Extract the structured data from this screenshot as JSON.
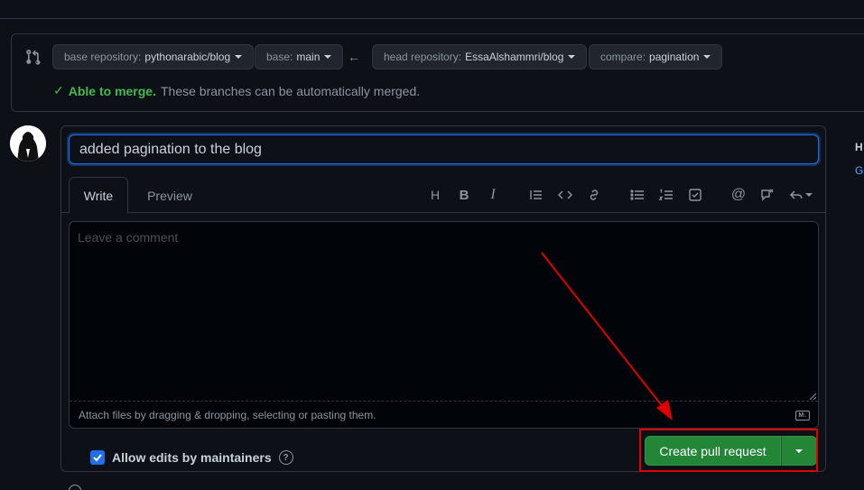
{
  "compare": {
    "base_repo_label": "base repository:",
    "base_repo_value": "pythonarabic/blog",
    "base_label": "base:",
    "base_value": "main",
    "head_repo_label": "head repository:",
    "head_repo_value": "EssaAlshammri/blog",
    "compare_label": "compare:",
    "compare_value": "pagination",
    "merge_ok": "Able to merge.",
    "merge_msg": "These branches can be automatically merged."
  },
  "pr": {
    "title_value": "added pagination to the blog",
    "tabs": {
      "write": "Write",
      "preview": "Preview"
    },
    "toolbar": [
      "heading-icon",
      "bold-icon",
      "italic-icon",
      "quote-icon",
      "code-icon",
      "link-icon",
      "unordered-list-icon",
      "ordered-list-icon",
      "task-list-icon",
      "mention-icon",
      "cross-reference-icon",
      "saved-reply-icon"
    ],
    "comment_placeholder": "Leave a comment",
    "attach_text": "Attach files by dragging & dropping, selecting or pasting them.",
    "allow_edits": "Allow edits by maintainers",
    "create_button": "Create pull request"
  },
  "sidebar": {
    "heading_fragment": "H",
    "link_fragment": "G"
  },
  "colors": {
    "background": "#0d1117",
    "border": "#30363d",
    "primary_green": "#238636",
    "success_text": "#3fb950",
    "focus_blue": "#1f6feb",
    "annotation_red": "#e00000"
  }
}
